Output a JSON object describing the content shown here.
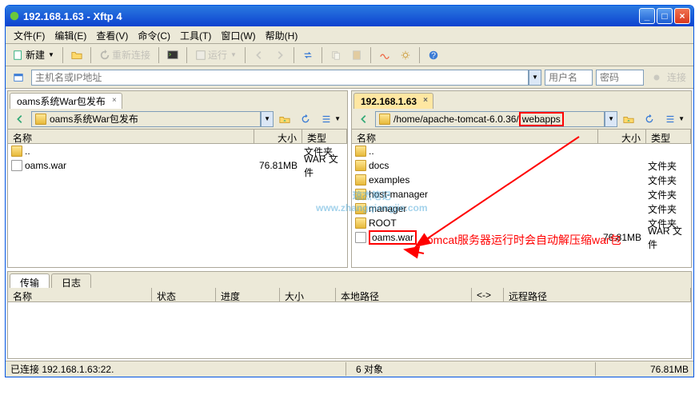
{
  "title": "192.168.1.63 - Xftp 4",
  "menu": [
    "文件(F)",
    "编辑(E)",
    "查看(V)",
    "命令(C)",
    "工具(T)",
    "窗口(W)",
    "帮助(H)"
  ],
  "toolbar": {
    "new": "新建",
    "reconnect": "重新连接",
    "run": "运行"
  },
  "hostbar": {
    "host_placeholder": "主机名或IP地址",
    "user_placeholder": "用户名",
    "pw_placeholder": "密码",
    "connect": "连接"
  },
  "leftPane": {
    "tab_label": "oams系统War包发布",
    "path": "oams系统War包发布",
    "columns": {
      "name": "名称",
      "size": "大小",
      "type": "类型"
    },
    "rows": [
      {
        "name": "..",
        "size": "",
        "type": "文件夹",
        "icon": "folder"
      },
      {
        "name": "oams.war",
        "size": "76.81MB",
        "type": "WAR 文件",
        "icon": "file"
      }
    ]
  },
  "rightPane": {
    "tab_label": "192.168.1.63",
    "path_prefix": "/home/apache-tomcat-6.0.36/",
    "path_highlight": "webapps",
    "columns": {
      "name": "名称",
      "size": "大小",
      "type": "类型"
    },
    "rows": [
      {
        "name": "..",
        "size": "",
        "type": "",
        "icon": "folder"
      },
      {
        "name": "docs",
        "size": "",
        "type": "文件夹",
        "icon": "folder"
      },
      {
        "name": "examples",
        "size": "",
        "type": "文件夹",
        "icon": "folder"
      },
      {
        "name": "host-manager",
        "size": "",
        "type": "文件夹",
        "icon": "folder"
      },
      {
        "name": "manager",
        "size": "",
        "type": "文件夹",
        "icon": "folder"
      },
      {
        "name": "ROOT",
        "size": "",
        "type": "文件夹",
        "icon": "folder"
      },
      {
        "name": "oams.war",
        "size": "76.81MB",
        "type": "WAR 文件",
        "icon": "file",
        "highlight": true
      }
    ],
    "annotation": "tomcat服务器运行时会自动解压缩war包"
  },
  "transfer": {
    "tabs": [
      "传输",
      "日志"
    ],
    "columns": [
      "名称",
      "状态",
      "进度",
      "大小",
      "本地路径",
      "<->",
      "远程路径"
    ]
  },
  "status": {
    "left": "已连接 192.168.1.63:22.",
    "mid": "6 对象",
    "right": "76.81MB"
  },
  "watermark_line1": "琼杰笔记",
  "watermark_line2": "www.zhangqiongjie.com"
}
